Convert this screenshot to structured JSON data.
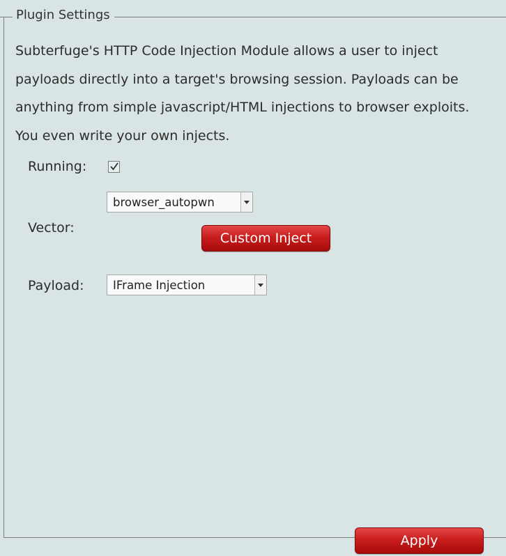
{
  "fieldset": {
    "legend": "Plugin Settings"
  },
  "description": "Subterfuge's HTTP Code Injection Module allows a user to inject payloads directly into a target's browsing session. Payloads can be anything from simple javascript/HTML injections to browser exploits. You even write your own injects.",
  "running": {
    "label": "Running:",
    "checked": true
  },
  "vector": {
    "label": "Vector:",
    "selected": "browser_autopwn",
    "custom_button_label": "Custom Inject"
  },
  "payload": {
    "label": "Payload:",
    "selected": "IFrame Injection"
  },
  "apply_label": "Apply",
  "colors": {
    "button_red": "#c91d1d",
    "background": "#d9e4e4"
  }
}
